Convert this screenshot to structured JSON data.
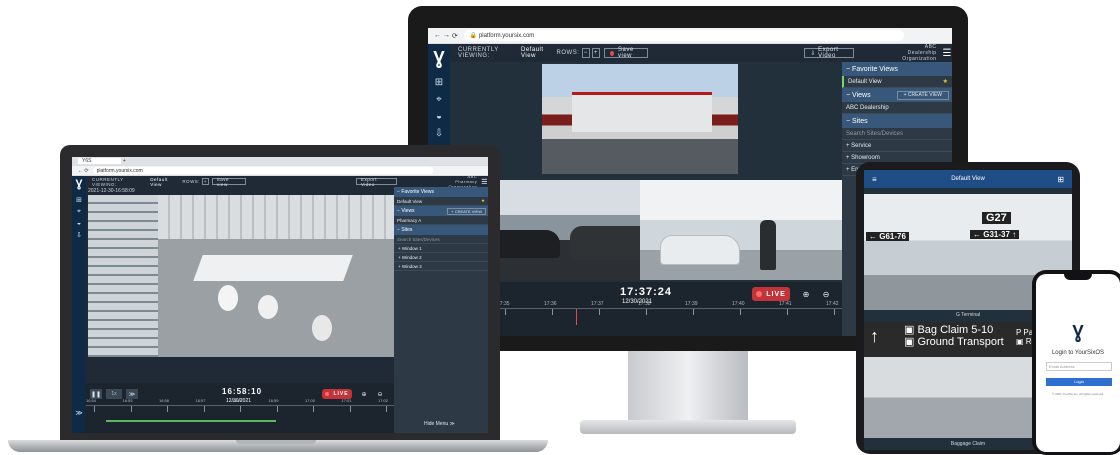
{
  "monitor": {
    "url": "platform.yoursix.com",
    "currently_viewing_label": "CURRENTLY VIEWING:",
    "current_view": "Default View",
    "rows_label": "ROWS:",
    "save_view": "Save view",
    "export_video": "Export Video",
    "org_line1": "ABC Dealership",
    "org_line2": "Organization",
    "favorite_views": "Favorite Views",
    "default_view": "Default View",
    "views": "Views",
    "create_view": "+ CREATE VIEW",
    "view_item": "ABC Dealership",
    "sites": "Sites",
    "search_placeholder": "Search Sites/Devices",
    "site_items": [
      "+ Service",
      "+ Showroom",
      "+ Entrance"
    ],
    "time": "17:37:24",
    "date": "12/30/2021",
    "live": "LIVE",
    "tick_labels": [
      "17:34",
      "17:35",
      "17:36",
      "17:37",
      "17:38",
      "17:39",
      "17:40",
      "17:41",
      "17:42"
    ]
  },
  "laptop": {
    "tab_title": "Y6S",
    "url": "platform.yoursix.com",
    "currently_viewing_label": "CURRENTLY VIEWING:",
    "current_view": "Default View",
    "rows_label": "ROWS:",
    "save_view": "Save view",
    "export_video": "Export Video",
    "org_line1": "ABC Pharmacy",
    "org_line2": "Organization",
    "timestamp": "2021-12-30-16:58:09",
    "favorite_views": "Favorite Views",
    "default_view": "Default View",
    "views": "Views",
    "create_view": "+ CREATE VIEW",
    "view_item": "Pharmacy A",
    "sites": "Sites",
    "search_placeholder": "Search Sites/Devices",
    "site_items": [
      "+ Window 1",
      "+ Window 2",
      "+ Window 3"
    ],
    "speed": "1x",
    "time": "16:58:10",
    "date": "12/30/2021",
    "live": "LIVE",
    "hide_menu": "Hide Menu",
    "tick_labels": [
      "16:54",
      "16:55",
      "16:56",
      "16:57",
      "16:58",
      "16:59",
      "17:00",
      "17:01",
      "17:02"
    ]
  },
  "tablet": {
    "title": "Default View",
    "cam1_sign": "G27",
    "cam1_sign2": "G61-76",
    "cam1_sign3": "G31-37",
    "cam1_label": "G Terminal",
    "cam2_sign1": "Bag Claim 5-10",
    "cam2_sign2": "Ground Transport",
    "cam2_sign3": "Parking",
    "cam2_sign4": "Rental",
    "cam2_label": "Baggage Claim"
  },
  "phone": {
    "title": "Login to YourSixOS",
    "username_placeholder": "Email Address",
    "login": "Login",
    "footer": "© 2021 YourSix Inc. All rights reserved."
  }
}
